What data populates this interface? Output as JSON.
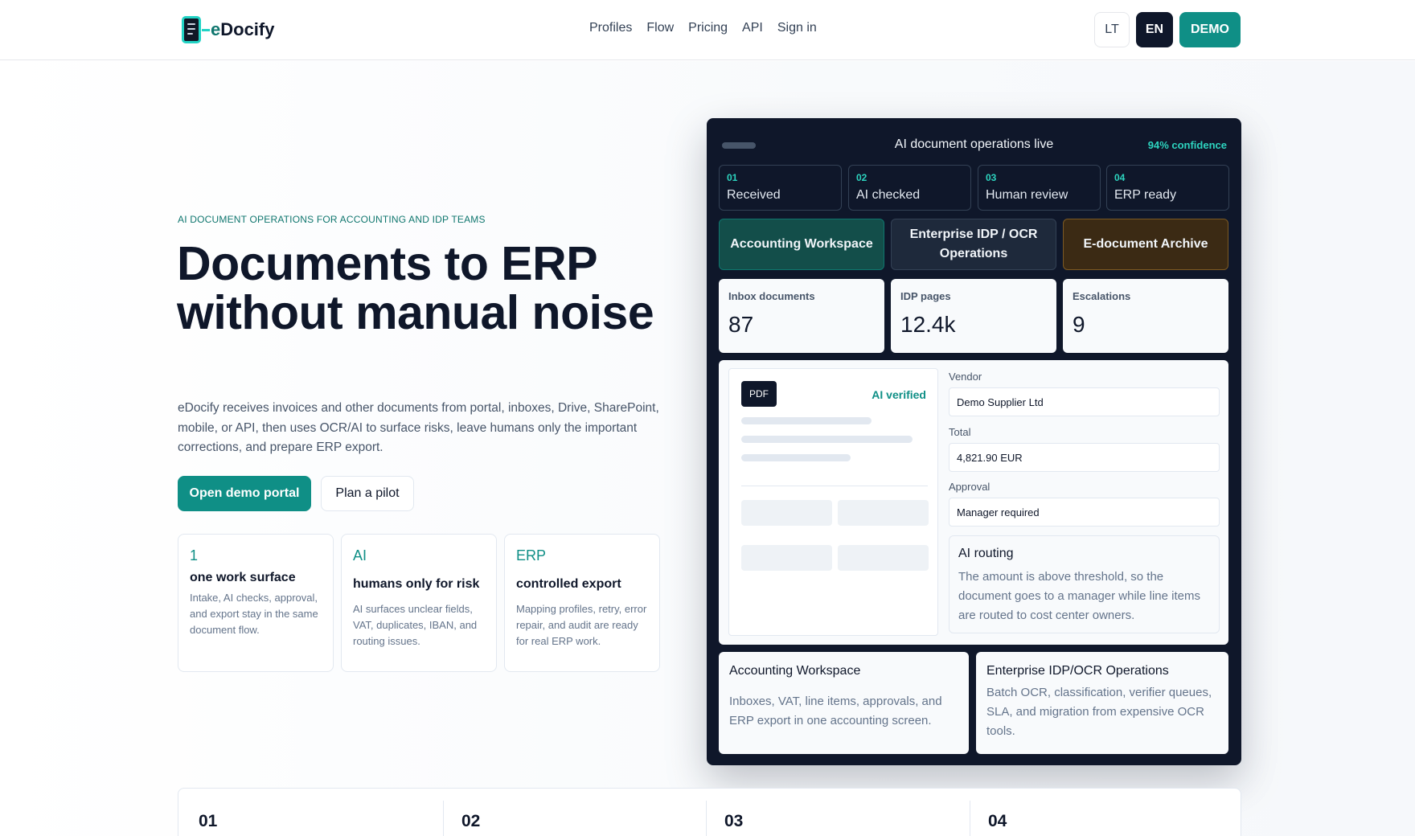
{
  "header": {
    "logo_e": "e",
    "logo_text": "Docify",
    "nav": [
      "Profiles",
      "Flow",
      "Pricing",
      "API",
      "Sign in"
    ],
    "lang_lt": "LT",
    "lang_en": "EN",
    "demo": "DEMO"
  },
  "hero": {
    "eyebrow": "AI DOCUMENT OPERATIONS FOR ACCOUNTING AND IDP TEAMS",
    "headline": "Documents to ERP without manual noise",
    "lead": "eDocify receives invoices and other documents from portal, inboxes, Drive, SharePoint, mobile, or API, then uses OCR/AI to surface risks, leave humans only the important corrections, and prepare ERP export.",
    "cta_primary": "Open demo portal",
    "cta_secondary": "Plan a pilot",
    "features": [
      {
        "big": "1",
        "title": "one work surface",
        "desc": "Intake, AI checks, approval, and export stay in the same document flow."
      },
      {
        "big": "AI",
        "title": "humans only for risk",
        "desc": "AI surfaces unclear fields, VAT, duplicates, IBAN, and routing issues."
      },
      {
        "big": "ERP",
        "title": "controlled export",
        "desc": "Mapping profiles, retry, error repair, and audit are ready for real ERP work."
      }
    ]
  },
  "dashboard": {
    "title": "AI document operations live",
    "confidence": "94% confidence",
    "steps": [
      {
        "num": "01",
        "label": "Received"
      },
      {
        "num": "02",
        "label": "AI checked"
      },
      {
        "num": "03",
        "label": "Human review"
      },
      {
        "num": "04",
        "label": "ERP ready"
      }
    ],
    "modes": [
      "Accounting Workspace",
      "Enterprise IDP / OCR Operations",
      "E-document Archive"
    ],
    "stats": [
      {
        "label": "Inbox documents",
        "value": "87"
      },
      {
        "label": "IDP pages",
        "value": "12.4k"
      },
      {
        "label": "Escalations",
        "value": "9"
      }
    ],
    "doc": {
      "badge": "PDF",
      "verified": "AI verified",
      "vendor_label": "Vendor",
      "vendor_value": "Demo Supplier Ltd",
      "total_label": "Total",
      "total_value": "4,821.90 EUR",
      "approval_label": "Approval",
      "approval_value": "Manager required",
      "routing_title": "AI routing",
      "routing_desc": "The amount is above threshold, so the document goes to a manager while line items are routed to cost center owners."
    },
    "cards": [
      {
        "title": "Accounting Workspace",
        "desc": "Inboxes, VAT, line items, approvals, and ERP export in one accounting screen."
      },
      {
        "title": "Enterprise IDP/OCR Operations",
        "desc": "Batch OCR, classification, verifier queues, SLA, and migration from expensive OCR tools."
      }
    ]
  },
  "bottom_steps": [
    "01",
    "02",
    "03",
    "04"
  ],
  "colors": {
    "accent": "#0f8f86",
    "dark": "#0f172a",
    "teal": "#2dd4bf"
  }
}
